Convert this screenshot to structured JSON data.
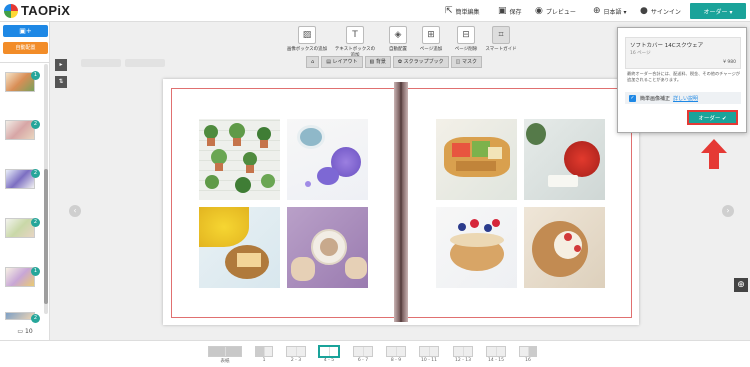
{
  "brand": {
    "name": "TAOPiX"
  },
  "header": {
    "nav": [
      {
        "icon": "share-icon",
        "label": "簡単編集"
      },
      {
        "icon": "save-icon",
        "label": "保存"
      },
      {
        "icon": "eye-icon",
        "label": "プレビュー"
      },
      {
        "icon": "globe-icon",
        "label": "日本語 ▾"
      },
      {
        "icon": "user-icon",
        "label": "サインイン"
      }
    ],
    "order_button": "オーダー ▾"
  },
  "sidebar": {
    "add_photos_label": "▣+",
    "auto_fill_label": "自動配置",
    "thumbs": [
      {
        "badge": "1"
      },
      {
        "badge": "2"
      },
      {
        "badge": "2"
      },
      {
        "badge": "2"
      },
      {
        "badge": "1"
      },
      {
        "badge": "2"
      }
    ],
    "photo_count": "10"
  },
  "toolbar": {
    "tools": [
      {
        "label": "画像ボックスの追加",
        "icon": "image-add-icon"
      },
      {
        "label": "テキストボックスの追加",
        "icon": "text-add-icon"
      },
      {
        "label": "自動配置",
        "icon": "auto-layout-icon"
      },
      {
        "label": "ページ追加",
        "icon": "page-add-icon"
      },
      {
        "label": "ページ削除",
        "icon": "page-delete-icon"
      },
      {
        "label": "スマートガイド",
        "icon": "smart-guide-icon"
      }
    ],
    "tabs": [
      {
        "label": "⌂"
      },
      {
        "label": "▤ レイアウト"
      },
      {
        "label": "▧ 背景"
      },
      {
        "label": "✿ スクラップブック"
      },
      {
        "label": "◫ マスク"
      }
    ]
  },
  "pages": [
    {
      "label": "表紙"
    },
    {
      "label": "1"
    },
    {
      "label": "2 - 3"
    },
    {
      "label": "4 - 5"
    },
    {
      "label": "6 - 7"
    },
    {
      "label": "8 - 9"
    },
    {
      "label": "10 - 11"
    },
    {
      "label": "12 - 13"
    },
    {
      "label": "14 - 15"
    },
    {
      "label": "16"
    }
  ],
  "active_page": "4 - 5",
  "order_popup": {
    "product_name": "ソフトカバー 14Cスクウェア",
    "pages": "16 ページ",
    "price": "¥ 980",
    "note": "最終オーダー合計には、配送料、税金、その他のチャージが追加されることがあります。",
    "checkbox_label": "簡単画像補正",
    "checkbox_link": "詳しい説明",
    "order_button": "オーダー ✔"
  },
  "colors": {
    "accent": "#1aa39a",
    "highlight": "#e53935",
    "primary": "#1e88e5",
    "orange": "#f28c28"
  }
}
